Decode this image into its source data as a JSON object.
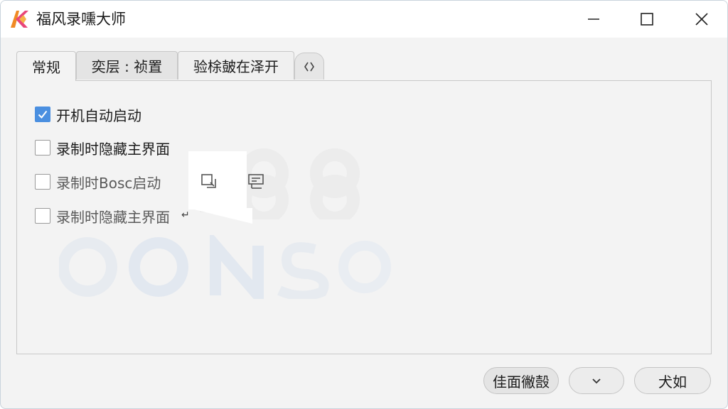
{
  "window": {
    "title": "福风录嚑大师",
    "logo": "app-logo-icon",
    "controls": [
      "minimize-icon",
      "maximize-icon",
      "close-icon"
    ]
  },
  "tabs": [
    {
      "label": "常规",
      "state": "active"
    },
    {
      "label": "奕层 : 祯置",
      "state": "inactive"
    },
    {
      "label": "验梌皷在泽开",
      "state": "mid"
    }
  ],
  "tab_more_icon": "chevron-left-right-icon",
  "options": [
    {
      "label": "开机自动启动",
      "checked": true
    },
    {
      "label": "录制时隐藏主界面",
      "checked": false
    },
    {
      "label": "录制时Bosc启动",
      "checked": false
    },
    {
      "label": "录制时隐藏主界面",
      "checked": false
    }
  ],
  "option_trailing_mark": "↵",
  "floating_icons": [
    "copy-window-icon",
    "edit-note-icon"
  ],
  "footer": {
    "reset_label": "佳面徶嗀",
    "dropdown_icon": "chevron-down-icon",
    "confirm_label": "犬如"
  },
  "colors": {
    "accent": "#4a8fe0",
    "logo_orange": "#f08a24",
    "logo_pink": "#e8467a"
  }
}
